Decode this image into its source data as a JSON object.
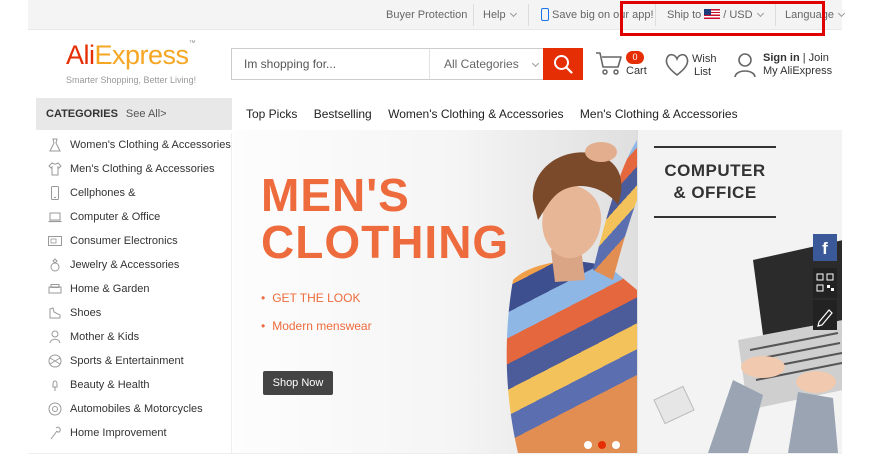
{
  "topbar": {
    "buyer_protection": "Buyer Protection",
    "help": "Help",
    "save_app": "Save big on our app!",
    "ship_to": "Ship to",
    "currency": "/ USD",
    "language": "Language"
  },
  "header": {
    "logo_ali": "Ali",
    "logo_express": "Express",
    "logo_tm": "™",
    "tagline": "Smarter Shopping, Better Living!",
    "search_placeholder": "Im shopping for...",
    "category_select": "All Categories",
    "cart_count": "0",
    "cart_label": "Cart",
    "wish_label_1": "Wish",
    "wish_label_2": "List",
    "sign_in": "Sign in",
    "join_sep": " | ",
    "join": "Join",
    "my_account": "My AliExpress"
  },
  "nav": {
    "categories_title": "CATEGORIES",
    "see_all": "See All>",
    "links": [
      "Top Picks",
      "Bestselling",
      "Women's Clothing & Accessories",
      "Men's Clothing & Accessories"
    ]
  },
  "categories": [
    {
      "label": "Women's Clothing & Accessories",
      "icon": "dress-icon"
    },
    {
      "label": "Men's Clothing & Accessories",
      "icon": "shirt-icon"
    },
    {
      "label": "Cellphones &",
      "icon": "phone-icon"
    },
    {
      "label": "Computer & Office",
      "icon": "laptop-icon"
    },
    {
      "label": "Consumer Electronics",
      "icon": "tv-icon"
    },
    {
      "label": "Jewelry & Accessories",
      "icon": "ring-icon"
    },
    {
      "label": "Home & Garden",
      "icon": "sofa-icon"
    },
    {
      "label": "Shoes",
      "icon": "shoe-icon"
    },
    {
      "label": "Mother & Kids",
      "icon": "baby-icon"
    },
    {
      "label": "Sports & Entertainment",
      "icon": "ball-icon"
    },
    {
      "label": "Beauty & Health",
      "icon": "lipstick-icon"
    },
    {
      "label": "Automobiles & Motorcycles",
      "icon": "wheel-icon"
    },
    {
      "label": "Home Improvement",
      "icon": "tools-icon"
    }
  ],
  "hero": {
    "title_line1": "MEN'S",
    "title_line2": "CLOTHING",
    "bullet1": "GET THE LOOK",
    "bullet2": "Modern menswear",
    "cta": "Shop Now"
  },
  "side_banner": {
    "title_line1": "COMPUTER",
    "title_line2": "& OFFICE"
  },
  "floating": {
    "facebook": "f"
  },
  "colors": {
    "brand_red": "#e62e04",
    "brand_orange": "#f5a623",
    "hero_orange": "#ed6b3c",
    "highlight_box": "#e00000"
  }
}
